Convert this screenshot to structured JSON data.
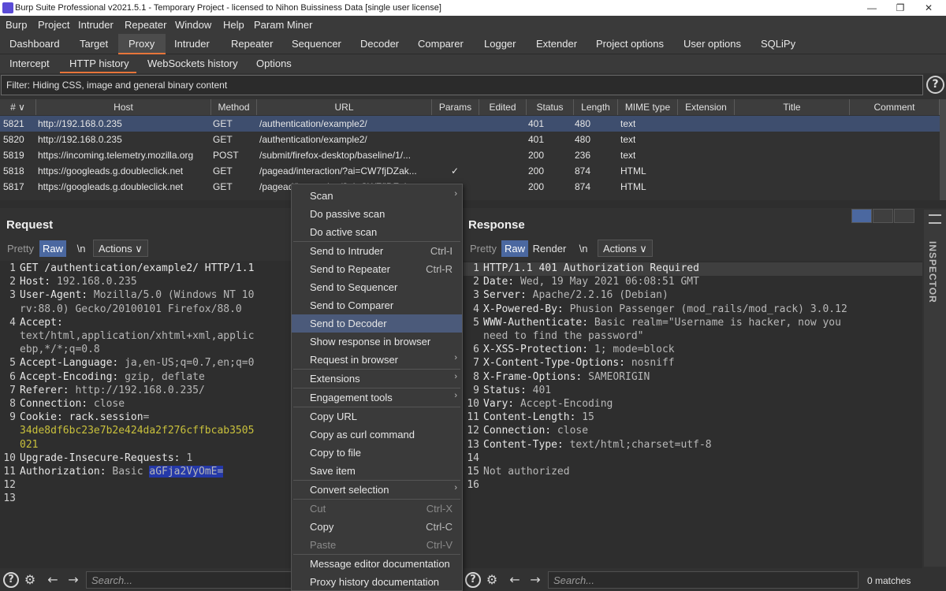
{
  "window": {
    "title": "Burp Suite Professional v2021.5.1 - Temporary Project - licensed to Nihon Buissiness Data [single user license]",
    "minimize": "—",
    "restore": "❐",
    "close": "✕"
  },
  "menubar": [
    "Burp",
    "Project",
    "Intruder",
    "Repeater",
    "Window",
    "Help",
    "Param Miner"
  ],
  "main_tabs": [
    "Dashboard",
    "Target",
    "Proxy",
    "Intruder",
    "Repeater",
    "Sequencer",
    "Decoder",
    "Comparer",
    "Logger",
    "Extender",
    "Project options",
    "User options",
    "SQLiPy"
  ],
  "active_main_tab": "Proxy",
  "sub_tabs": [
    "Intercept",
    "HTTP history",
    "WebSockets history",
    "Options"
  ],
  "active_sub_tab": "HTTP history",
  "filter": {
    "text": "Filter: Hiding CSS, image and general binary content",
    "help": "?"
  },
  "history": {
    "columns": [
      "# ∨",
      "Host",
      "Method",
      "URL",
      "Params",
      "Edited",
      "Status",
      "Length",
      "MIME type",
      "Extension",
      "Title",
      "Comment"
    ],
    "rows": [
      {
        "num": "5821",
        "host": "http://192.168.0.235",
        "method": "GET",
        "url": "/authentication/example2/",
        "params": "",
        "status": "401",
        "length": "480",
        "mime": "text"
      },
      {
        "num": "5820",
        "host": "http://192.168.0.235",
        "method": "GET",
        "url": "/authentication/example2/",
        "params": "",
        "status": "401",
        "length": "480",
        "mime": "text"
      },
      {
        "num": "5819",
        "host": "https://incoming.telemetry.mozilla.org",
        "method": "POST",
        "url": "/submit/firefox-desktop/baseline/1/...",
        "params": "",
        "status": "200",
        "length": "236",
        "mime": "text"
      },
      {
        "num": "5818",
        "host": "https://googleads.g.doubleclick.net",
        "method": "GET",
        "url": "/pagead/interaction/?ai=CW7fjDZak...",
        "params": "✓",
        "status": "200",
        "length": "874",
        "mime": "HTML"
      },
      {
        "num": "5817",
        "host": "https://googleads.g.doubleclick.net",
        "method": "GET",
        "url": "/pagead/interaction/?ai=CW7fjDZak...",
        "params": "✓",
        "status": "200",
        "length": "874",
        "mime": "HTML"
      }
    ]
  },
  "request": {
    "title": "Request",
    "view_buttons": [
      "Pretty",
      "Raw",
      "\\n"
    ],
    "active_view": "Raw",
    "actions": "Actions ∨",
    "lines": [
      {
        "n": "1",
        "parts": [
          {
            "t": "GET /authentication/example2/ HTTP/1.1",
            "c": "k"
          }
        ]
      },
      {
        "n": "2",
        "parts": [
          {
            "t": "Host: ",
            "c": "k"
          },
          {
            "t": "192.168.0.235",
            "c": ""
          }
        ]
      },
      {
        "n": "3",
        "parts": [
          {
            "t": "User-Agent: ",
            "c": "k"
          },
          {
            "t": "Mozilla/5.0 (Windows NT 10",
            "c": ""
          }
        ]
      },
      {
        "n": "",
        "parts": [
          {
            "t": "rv:88.0) Gecko/20100101 Firefox/88.0",
            "c": ""
          }
        ]
      },
      {
        "n": "4",
        "parts": [
          {
            "t": "Accept:",
            "c": "k"
          }
        ]
      },
      {
        "n": "",
        "parts": [
          {
            "t": "text/html,application/xhtml+xml,applic",
            "c": ""
          }
        ]
      },
      {
        "n": "",
        "parts": [
          {
            "t": "ebp,*/*;q=0.8",
            "c": ""
          }
        ]
      },
      {
        "n": "5",
        "parts": [
          {
            "t": "Accept-Language: ",
            "c": "k"
          },
          {
            "t": "ja,en-US;q=0.7,en;q=0",
            "c": ""
          }
        ]
      },
      {
        "n": "6",
        "parts": [
          {
            "t": "Accept-Encoding: ",
            "c": "k"
          },
          {
            "t": "gzip, deflate",
            "c": ""
          }
        ]
      },
      {
        "n": "7",
        "parts": [
          {
            "t": "Referer: ",
            "c": "k"
          },
          {
            "t": "http://192.168.0.235/",
            "c": ""
          }
        ]
      },
      {
        "n": "8",
        "parts": [
          {
            "t": "Connection: ",
            "c": "k"
          },
          {
            "t": "close",
            "c": ""
          }
        ]
      },
      {
        "n": "9",
        "parts": [
          {
            "t": "Cookie: ",
            "c": "k"
          },
          {
            "t": "rack.session",
            "c": "k"
          },
          {
            "t": "=",
            "c": ""
          }
        ]
      },
      {
        "n": "",
        "parts": [
          {
            "t": "34de8df6bc23e7b2e424da2f276cffbcab3505",
            "c": "g"
          }
        ]
      },
      {
        "n": "",
        "parts": [
          {
            "t": "021",
            "c": "g"
          }
        ]
      },
      {
        "n": "10",
        "parts": [
          {
            "t": "Upgrade-Insecure-Requests: ",
            "c": "k"
          },
          {
            "t": "1",
            "c": ""
          }
        ]
      },
      {
        "n": "11",
        "parts": [
          {
            "t": "Authorization: ",
            "c": "k"
          },
          {
            "t": "Basic ",
            "c": ""
          },
          {
            "t": "aGFja2VyOmE=",
            "c": "hl"
          }
        ]
      },
      {
        "n": "12",
        "parts": []
      },
      {
        "n": "13",
        "parts": []
      }
    ],
    "search_placeholder": "Search..."
  },
  "response": {
    "title": "Response",
    "view_buttons": [
      "Pretty",
      "Raw",
      "Render",
      "\\n"
    ],
    "active_view": "Raw",
    "actions": "Actions ∨",
    "lines": [
      {
        "n": "1",
        "parts": [
          {
            "t": "HTTP/1.1 401 Authorization Required",
            "c": "k"
          }
        ]
      },
      {
        "n": "2",
        "parts": [
          {
            "t": "Date: ",
            "c": "k"
          },
          {
            "t": "Wed, 19 May 2021 06:08:51 GMT",
            "c": ""
          }
        ]
      },
      {
        "n": "3",
        "parts": [
          {
            "t": "Server: ",
            "c": "k"
          },
          {
            "t": "Apache/2.2.16 (Debian)",
            "c": ""
          }
        ]
      },
      {
        "n": "4",
        "parts": [
          {
            "t": "X-Powered-By: ",
            "c": "k"
          },
          {
            "t": "Phusion Passenger (mod_rails/mod_rack) 3.0.12",
            "c": ""
          }
        ]
      },
      {
        "n": "5",
        "parts": [
          {
            "t": "WWW-Authenticate: ",
            "c": "k"
          },
          {
            "t": "Basic realm=\"Username is hacker, now you",
            "c": ""
          }
        ]
      },
      {
        "n": "",
        "parts": [
          {
            "t": "need to find the password\"",
            "c": ""
          }
        ]
      },
      {
        "n": "6",
        "parts": [
          {
            "t": "X-XSS-Protection: ",
            "c": "k"
          },
          {
            "t": "1; mode=block",
            "c": ""
          }
        ]
      },
      {
        "n": "7",
        "parts": [
          {
            "t": "X-Content-Type-Options: ",
            "c": "k"
          },
          {
            "t": "nosniff",
            "c": ""
          }
        ]
      },
      {
        "n": "8",
        "parts": [
          {
            "t": "X-Frame-Options: ",
            "c": "k"
          },
          {
            "t": "SAMEORIGIN",
            "c": ""
          }
        ]
      },
      {
        "n": "9",
        "parts": [
          {
            "t": "Status: ",
            "c": "k"
          },
          {
            "t": "401",
            "c": ""
          }
        ]
      },
      {
        "n": "10",
        "parts": [
          {
            "t": "Vary: ",
            "c": "k"
          },
          {
            "t": "Accept-Encoding",
            "c": ""
          }
        ]
      },
      {
        "n": "11",
        "parts": [
          {
            "t": "Content-Length: ",
            "c": "k"
          },
          {
            "t": "15",
            "c": ""
          }
        ]
      },
      {
        "n": "12",
        "parts": [
          {
            "t": "Connection: ",
            "c": "k"
          },
          {
            "t": "close",
            "c": ""
          }
        ]
      },
      {
        "n": "13",
        "parts": [
          {
            "t": "Content-Type: ",
            "c": "k"
          },
          {
            "t": "text/html;charset=utf-8",
            "c": ""
          }
        ]
      },
      {
        "n": "14",
        "parts": []
      },
      {
        "n": "15",
        "parts": [
          {
            "t": "Not authorized",
            "c": ""
          }
        ]
      },
      {
        "n": "16",
        "parts": []
      }
    ],
    "search_placeholder": "Search...",
    "matches": "0 matches"
  },
  "inspector": {
    "label": "INSPECTOR"
  },
  "context_menu": {
    "items": [
      {
        "label": "Scan",
        "shortcut": "",
        "submenu": true,
        "disabled": false
      },
      {
        "label": "Do passive scan",
        "shortcut": "",
        "submenu": false,
        "disabled": false
      },
      {
        "label": "Do active scan",
        "shortcut": "",
        "submenu": false,
        "disabled": false,
        "sep_after": true
      },
      {
        "label": "Send to Intruder",
        "shortcut": "Ctrl-I",
        "submenu": false,
        "disabled": false
      },
      {
        "label": "Send to Repeater",
        "shortcut": "Ctrl-R",
        "submenu": false,
        "disabled": false
      },
      {
        "label": "Send to Sequencer",
        "shortcut": "",
        "submenu": false,
        "disabled": false
      },
      {
        "label": "Send to Comparer",
        "shortcut": "",
        "submenu": false,
        "disabled": false
      },
      {
        "label": "Send to Decoder",
        "shortcut": "",
        "submenu": false,
        "disabled": false,
        "selected": true
      },
      {
        "label": "Show response in browser",
        "shortcut": "",
        "submenu": false,
        "disabled": false
      },
      {
        "label": "Request in browser",
        "shortcut": "",
        "submenu": true,
        "disabled": false,
        "sep_after": true
      },
      {
        "label": "Extensions",
        "shortcut": "",
        "submenu": true,
        "disabled": false,
        "sep_after": true
      },
      {
        "label": "Engagement tools",
        "shortcut": "",
        "submenu": true,
        "disabled": false,
        "sep_after": true
      },
      {
        "label": "Copy URL",
        "shortcut": "",
        "submenu": false,
        "disabled": false
      },
      {
        "label": "Copy as curl command",
        "shortcut": "",
        "submenu": false,
        "disabled": false
      },
      {
        "label": "Copy to file",
        "shortcut": "",
        "submenu": false,
        "disabled": false
      },
      {
        "label": "Save item",
        "shortcut": "",
        "submenu": false,
        "disabled": false,
        "sep_after": true
      },
      {
        "label": "Convert selection",
        "shortcut": "",
        "submenu": true,
        "disabled": false,
        "sep_after": true
      },
      {
        "label": "Cut",
        "shortcut": "Ctrl-X",
        "submenu": false,
        "disabled": true
      },
      {
        "label": "Copy",
        "shortcut": "Ctrl-C",
        "submenu": false,
        "disabled": false
      },
      {
        "label": "Paste",
        "shortcut": "Ctrl-V",
        "submenu": false,
        "disabled": true,
        "sep_after": true
      },
      {
        "label": "Message editor documentation",
        "shortcut": "",
        "submenu": false,
        "disabled": false
      },
      {
        "label": "Proxy history documentation",
        "shortcut": "",
        "submenu": false,
        "disabled": false
      }
    ]
  },
  "colors": {
    "accent": "#e8753a",
    "selection": "#3e4e6e",
    "highlight": "#2438a8",
    "cookie_value": "#c9c13c"
  }
}
